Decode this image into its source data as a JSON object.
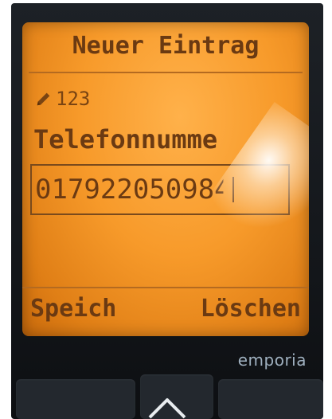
{
  "screen": {
    "title": "Neuer Eintrag",
    "input_mode": "123",
    "field_label": "Telefonnumme",
    "phone_value": "01792205098",
    "partial_char": "4"
  },
  "softkeys": {
    "left_label": "Speich",
    "right_label": "Löschen"
  },
  "device": {
    "brand": "emporia"
  },
  "icons": {
    "input_mode_icon": "pencil-icon",
    "nav_icon": "up-arrow-icon"
  },
  "colors": {
    "screen_backlight": "#f79a2a",
    "lcd_text": "#6b3a12",
    "phone_body": "#14171b",
    "brand_text": "#9fb0bf"
  }
}
